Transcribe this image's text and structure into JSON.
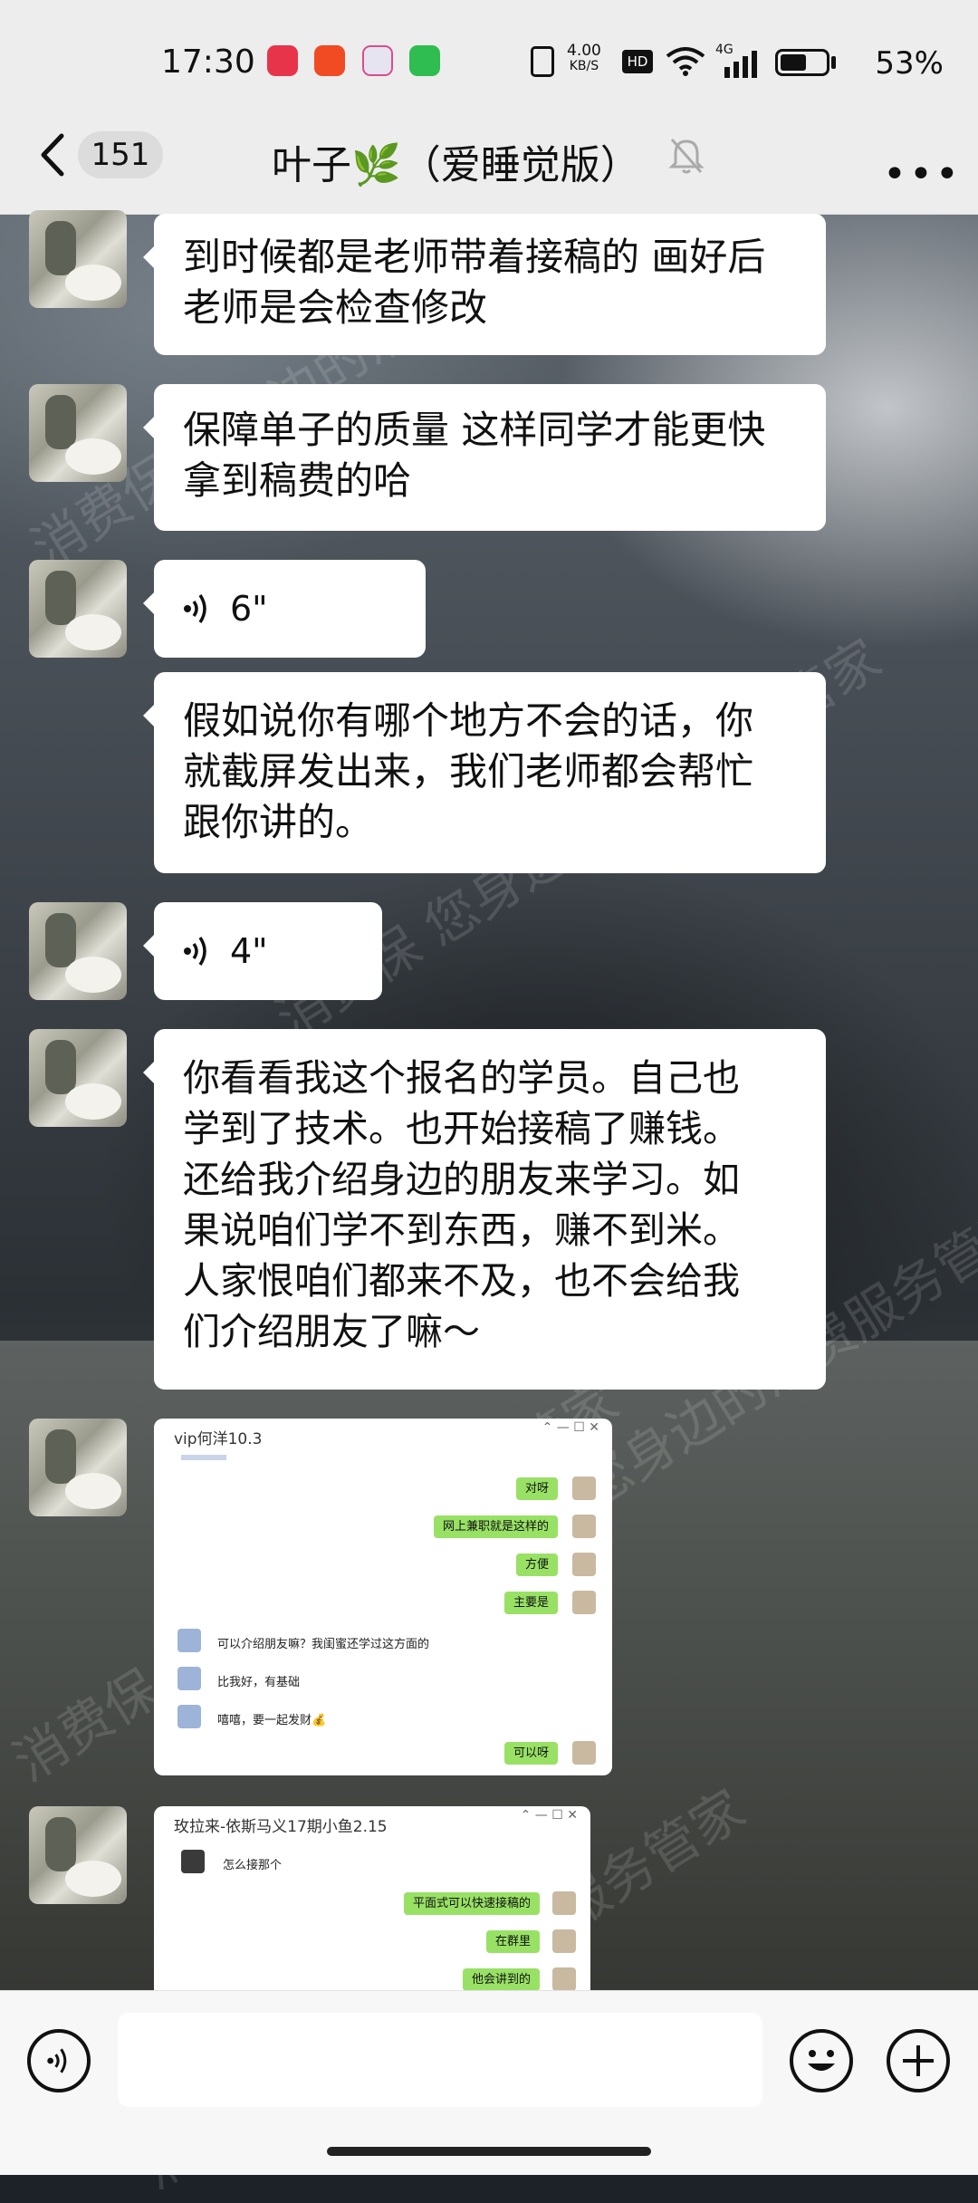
{
  "status_bar": {
    "time": "17:30",
    "net_speed_value": "4.00",
    "net_speed_unit": "KB/S",
    "hd": "HD",
    "signal": "4G",
    "battery": "53%"
  },
  "header": {
    "unread_count": "151",
    "title": "叶子🌿（爱睡觉版）"
  },
  "watermark": "消费保 您身边的消费服务管家",
  "messages": [
    {
      "type": "text",
      "lines": [
        "到时候都是老师带着接稿的 画好后",
        "老师是会检查修改"
      ]
    },
    {
      "type": "text",
      "lines": [
        "保障单子的质量 这样同学才能更快",
        "拿到稿费的哈"
      ]
    },
    {
      "type": "voice",
      "duration": "6\""
    },
    {
      "type": "text",
      "lines": [
        "假如说你有哪个地方不会的话，你",
        "就截屏发出来，我们老师都会帮忙",
        "跟你讲的。"
      ]
    },
    {
      "type": "voice",
      "duration": "4\""
    },
    {
      "type": "text",
      "lines": [
        "你看看我这个报名的学员。自己也",
        "学到了技术。也开始接稿了赚钱。",
        "还给我介绍身边的朋友来学习。如",
        "果说咱们学不到东西，赚不到米。",
        "人家恨咱们都来不及，也不会给我",
        "们介绍朋友了嘛～"
      ]
    }
  ],
  "screenshot1": {
    "title": "vip何洋10.3",
    "rows": [
      {
        "side": "right",
        "text": "对呀"
      },
      {
        "side": "right",
        "text": "网上兼职就是这样的"
      },
      {
        "side": "right",
        "text": "方便"
      },
      {
        "side": "right",
        "text": "主要是"
      },
      {
        "side": "left",
        "text": "可以介绍朋友嘛？我闺蜜还学过这方面的"
      },
      {
        "side": "left",
        "text": "比我好，有基础"
      },
      {
        "side": "left",
        "text": "嘻嘻，要一起发财💰"
      },
      {
        "side": "right",
        "text": "可以呀"
      }
    ]
  },
  "screenshot2": {
    "title": "玫拉来-依斯马义17期小鱼2.15",
    "rows": [
      {
        "side": "left",
        "text": "怎么接那个"
      },
      {
        "side": "right",
        "text": "平面式可以快速接稿的"
      },
      {
        "side": "right",
        "text": "在群里"
      },
      {
        "side": "right",
        "text": "他会讲到的"
      }
    ]
  },
  "colors": {
    "nav_bg": "#ededed",
    "bubble_bg": "#ffffff",
    "wechat_green": "#98e165"
  },
  "icons": [
    "back-arrow-icon",
    "mute-bell-icon",
    "more-icon",
    "voice-icon",
    "emoji-icon",
    "plus-icon"
  ]
}
